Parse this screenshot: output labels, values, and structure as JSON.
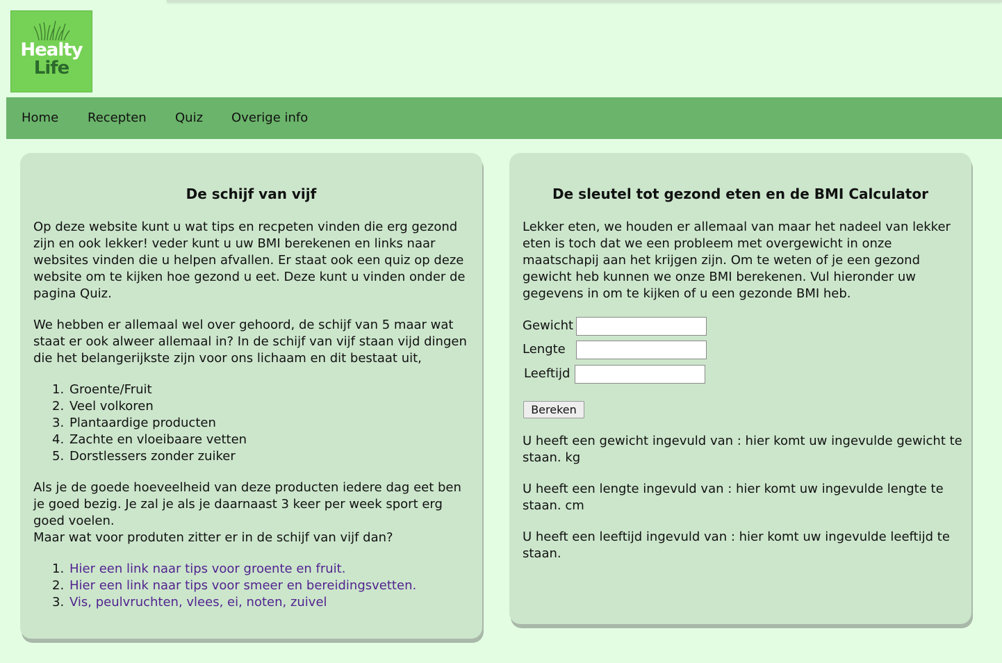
{
  "logo": {
    "line1": "Healty",
    "line2": "Life"
  },
  "nav": {
    "items": [
      "Home",
      "Recepten",
      "Quiz",
      "Overige info"
    ]
  },
  "left": {
    "title": "De schijf van vijf",
    "intro": "Op deze website kunt u wat tips en recpeten vinden die erg gezond zijn en ook lekker! veder kunt u uw BMI berekenen en links naar websites vinden die u helpen afvallen. Er staat ook een quiz op deze website om te kijken hoe gezond u eet. Deze kunt u vinden onder de pagina Quiz.",
    "para2": "We hebben er allemaal wel over gehoord, de schijf van 5 maar wat staat er ook alweer allemaal in? In de schijf van vijf staan vijd dingen die het belangerijkste zijn voor ons lichaam en dit bestaat uit,",
    "list": [
      "Groente/Fruit",
      "Veel volkoren",
      "Plantaardige producten",
      "Zachte en vloeibaare vetten",
      "Dorstlessers zonder zuiker"
    ],
    "para3": "Als je de goede hoeveelheid van deze producten iedere dag eet ben je goed bezig. Je zal je als je daarnaast 3 keer per week sport erg goed voelen.",
    "para4": "Maar wat voor produten zitter er in de schijf van vijf dan?",
    "links": [
      "Hier een link naar tips voor groente en fruit.",
      "Hier een link naar tips voor smeer en bereidingsvetten.",
      "Vis, peulvruchten, vlees, ei, noten, zuivel"
    ]
  },
  "right": {
    "title": "De sleutel tot gezond eten en de BMI Calculator",
    "intro": "Lekker eten, we houden er allemaal van maar het nadeel van lekker eten is toch dat we een probleem met overgewicht in onze maatschapij aan het krijgen zijn. Om te weten of je een gezond gewicht heb kunnen we onze BMI berekenen. Vul hieronder uw gegevens in om te kijken of u een gezonde BMI heb.",
    "fields": [
      {
        "label": "Gewicht",
        "value": ""
      },
      {
        "label": "Lengte",
        "value": ""
      },
      {
        "label": "Leeftijd",
        "value": ""
      }
    ],
    "button": "Bereken",
    "results": [
      "U heeft een gewicht ingevuld van : hier komt uw ingevulde gewicht te staan. kg",
      "U heeft een lengte ingevuld van : hier komt uw ingevulde lengte te staan. cm",
      "U heeft een leeftijd ingevuld van : hier komt uw ingevulde leeftijd te staan."
    ]
  },
  "colors": {
    "background": "#e3fde3",
    "nav": "#6bb46b",
    "card": "#cce6cc",
    "logo": "#76d256",
    "link": "#51238f"
  }
}
